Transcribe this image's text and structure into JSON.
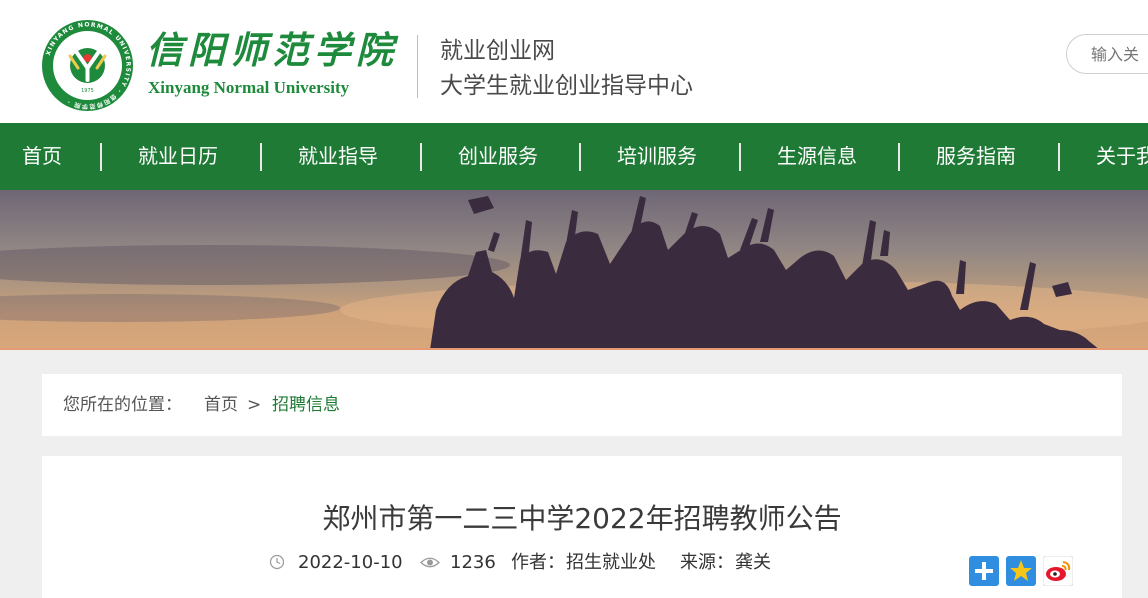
{
  "header": {
    "logo_cn": "信阳师范学院",
    "logo_en": "Xinyang Normal University",
    "logo_seal_text": "信阳师范学院 XINYANG NORMAL UNIVERSITY 1975",
    "site_name": "就业创业网",
    "site_subtitle": "大学生就业创业指导中心",
    "search_placeholder": "输入关"
  },
  "nav": {
    "items": [
      "首页",
      "就业日历",
      "就业指导",
      "创业服务",
      "培训服务",
      "生源信息",
      "服务指南",
      "关于我们"
    ]
  },
  "breadcrumb": {
    "prefix": "您所在的位置：",
    "home": "首页",
    "separator": ">",
    "current": "招聘信息"
  },
  "article": {
    "title": "郑州市第一二三中学2022年招聘教师公告",
    "date": "2022-10-10",
    "views": "1236",
    "author_label": "作者：",
    "author": "招生就业处",
    "source_label": "来源：",
    "source": "龚关"
  },
  "share": {
    "icons": [
      "share-plus-icon",
      "favorite-star-icon",
      "weibo-icon"
    ]
  },
  "colors": {
    "brand_green": "#1e8a3c",
    "nav_green": "#1f7a36",
    "breadcrumb_current": "#1f7a36"
  }
}
